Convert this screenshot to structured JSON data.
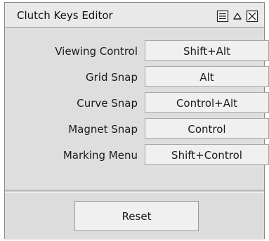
{
  "window": {
    "title": "Clutch Keys Editor"
  },
  "titlebar_icons": [
    "menu-icon",
    "collapse-icon",
    "close-icon"
  ],
  "rows": [
    {
      "label": "Viewing Control",
      "value": "Shift+Alt"
    },
    {
      "label": "Grid Snap",
      "value": "Alt"
    },
    {
      "label": "Curve Snap",
      "value": "Control+Alt"
    },
    {
      "label": "Magnet Snap",
      "value": "Control"
    },
    {
      "label": "Marking Menu",
      "value": "Shift+Control"
    }
  ],
  "footer": {
    "reset_label": "Reset"
  },
  "colors": {
    "panel_background": "#dedede",
    "button_background": "#f0f0f0",
    "border": "#9a9a9a"
  }
}
